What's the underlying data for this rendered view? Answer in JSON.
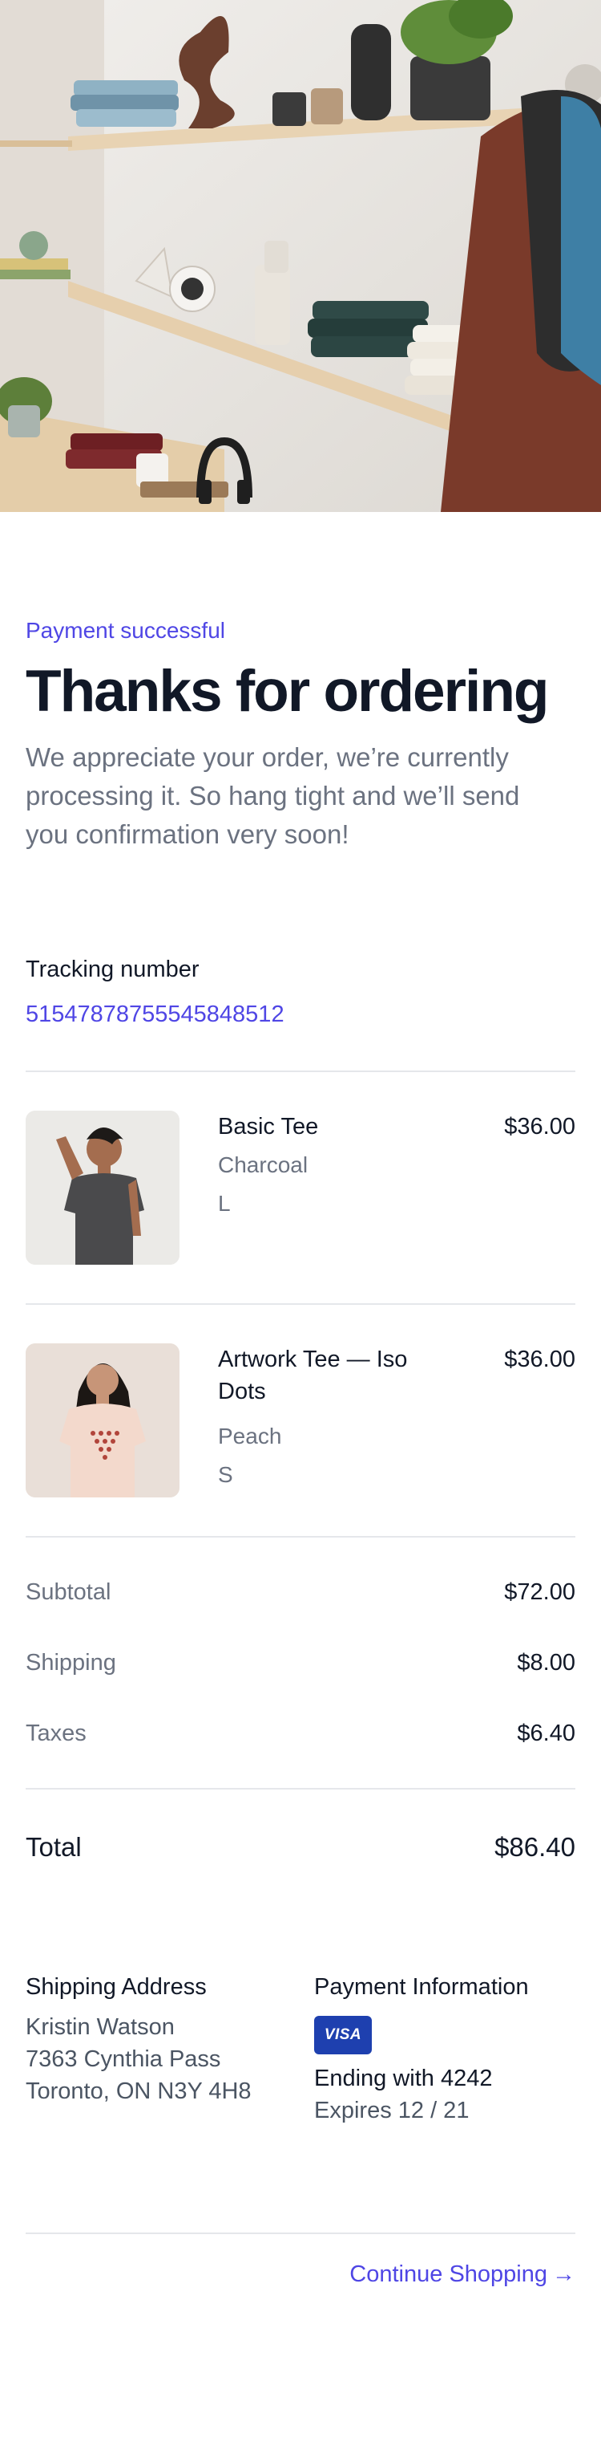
{
  "hero": {
    "alt_icon": "shelves-photo"
  },
  "order": {
    "status": "Payment successful",
    "title": "Thanks for ordering",
    "intro": "We appreciate your order, we’re currently processing it. So hang tight and we’ll send you confirmation very soon!",
    "tracking_label": "Tracking number",
    "tracking_number": "51547878755545848512"
  },
  "products": [
    {
      "name": "Basic Tee",
      "color": "Charcoal",
      "size": "L",
      "price": "$36.00"
    },
    {
      "name": "Artwork Tee — Iso Dots",
      "color": "Peach",
      "size": "S",
      "price": "$36.00"
    }
  ],
  "summary": {
    "subtotal_label": "Subtotal",
    "subtotal": "$72.00",
    "shipping_label": "Shipping",
    "shipping": "$8.00",
    "taxes_label": "Taxes",
    "taxes": "$6.40",
    "total_label": "Total",
    "total": "$86.40"
  },
  "shipping_address": {
    "title": "Shipping Address",
    "name": "Kristin Watson",
    "street": "7363 Cynthia Pass",
    "city": "Toronto, ON N3Y 4H8"
  },
  "payment": {
    "title": "Payment Information",
    "card_brand": "VISA",
    "ending": "Ending with 4242",
    "expires": "Expires 12 / 21"
  },
  "actions": {
    "continue_label": "Continue Shopping",
    "continue_arrow": "→"
  },
  "colors": {
    "accent": "#4f46e5",
    "text": "#111827",
    "muted": "#6b7280",
    "divider": "#e5e7eb",
    "visa": "#1e40af"
  }
}
